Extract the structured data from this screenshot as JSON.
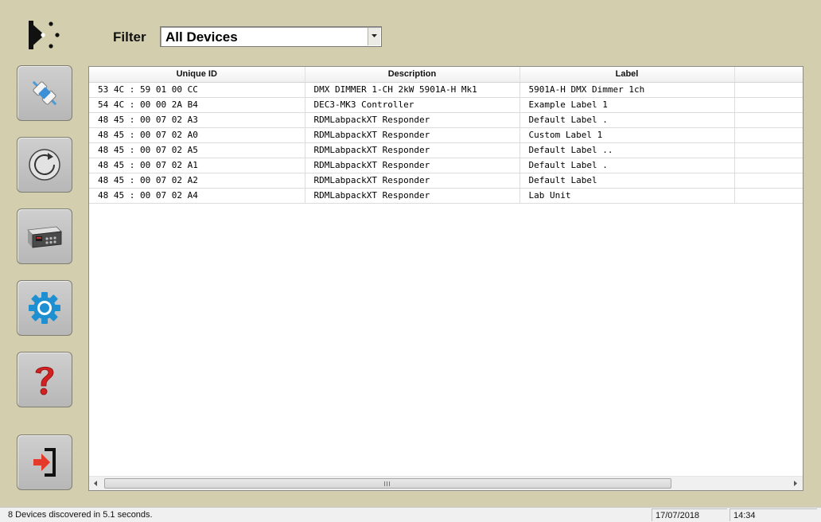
{
  "filter": {
    "label": "Filter",
    "selected": "All Devices"
  },
  "sidebar": {
    "buttons": [
      {
        "id": "connect",
        "icon": "connector-icon"
      },
      {
        "id": "refresh",
        "icon": "refresh-icon"
      },
      {
        "id": "device",
        "icon": "device-icon"
      },
      {
        "id": "settings",
        "icon": "gear-icon"
      },
      {
        "id": "help",
        "icon": "question-icon"
      },
      {
        "id": "exit",
        "icon": "exit-icon"
      }
    ]
  },
  "table": {
    "columns": [
      "Unique ID",
      "Description",
      "Label",
      ""
    ],
    "rows": [
      {
        "uid": "53 4C : 59 01 00 CC",
        "description": "DMX DIMMER 1-CH 2kW 5901A-H Mk1",
        "label": "5901A-H DMX Dimmer 1ch"
      },
      {
        "uid": "54 4C : 00 00 2A B4",
        "description": "DEC3-MK3 Controller",
        "label": "Example Label 1"
      },
      {
        "uid": "48 45 : 00 07 02 A3",
        "description": "RDMLabpackXT Responder",
        "label": "Default Label ."
      },
      {
        "uid": "48 45 : 00 07 02 A0",
        "description": "RDMLabpackXT Responder",
        "label": "Custom Label 1"
      },
      {
        "uid": "48 45 : 00 07 02 A5",
        "description": "RDMLabpackXT Responder",
        "label": "Default Label .."
      },
      {
        "uid": "48 45 : 00 07 02 A1",
        "description": "RDMLabpackXT Responder",
        "label": "Default Label ."
      },
      {
        "uid": "48 45 : 00 07 02 A2",
        "description": "RDMLabpackXT Responder",
        "label": "Default Label"
      },
      {
        "uid": "48 45 : 00 07 02 A4",
        "description": "RDMLabpackXT Responder",
        "label": "Lab Unit"
      }
    ]
  },
  "status": {
    "message": "8 Devices discovered in 5.1 seconds.",
    "date": "17/07/2018",
    "time": "14:34"
  },
  "colors": {
    "background": "#d3cfae",
    "accent_blue": "#1e8fd0",
    "help_red": "#d32020",
    "exit_red": "#e53a2a"
  }
}
